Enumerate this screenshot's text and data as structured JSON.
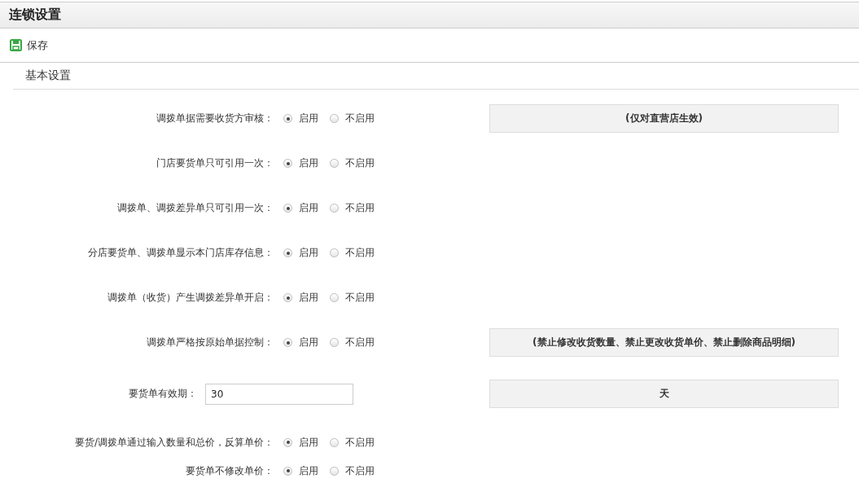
{
  "title": "连锁设置",
  "toolbar": [
    {
      "label": "保存",
      "kind": "save"
    }
  ],
  "section": {
    "title": "基本设置"
  },
  "settings": [
    {
      "kind": "radio",
      "label": "调拨单据需要收货方审核：",
      "options": [
        {
          "label": "启用",
          "selected": true
        },
        {
          "label": "不启用",
          "selected": false
        }
      ],
      "note": "(仅对直营店生效)"
    },
    {
      "kind": "radio",
      "label": "门店要货单只可引用一次：",
      "options": [
        {
          "label": "启用",
          "selected": true
        },
        {
          "label": "不启用",
          "selected": false
        }
      ]
    },
    {
      "kind": "radio",
      "label": "调拨单、调拨差异单只可引用一次：",
      "options": [
        {
          "label": "启用",
          "selected": true
        },
        {
          "label": "不启用",
          "selected": false
        }
      ]
    },
    {
      "kind": "radio",
      "label": "分店要货单、调拨单显示本门店库存信息：",
      "options": [
        {
          "label": "启用",
          "selected": true
        },
        {
          "label": "不启用",
          "selected": false
        }
      ]
    },
    {
      "kind": "radio",
      "label": "调拨单（收货）产生调拨差异单开启：",
      "options": [
        {
          "label": "启用",
          "selected": true
        },
        {
          "label": "不启用",
          "selected": false
        }
      ]
    },
    {
      "kind": "radio",
      "label": "调拨单严格按原始单据控制：",
      "options": [
        {
          "label": "启用",
          "selected": true
        },
        {
          "label": "不启用",
          "selected": false
        }
      ],
      "note": "(禁止修改收货数量、禁止更改收货单价、禁止删除商品明细)"
    },
    {
      "kind": "number",
      "label": "要货单有效期：",
      "value": "30",
      "note": "天"
    },
    {
      "kind": "radio",
      "label": "要货/调拨单通过输入数量和总价，反算单价：",
      "options": [
        {
          "label": "启用",
          "selected": true
        },
        {
          "label": "不启用",
          "selected": false
        }
      ]
    },
    {
      "kind": "radio",
      "label": "要货单不修改单价：",
      "options": [
        {
          "label": "启用",
          "selected": true
        },
        {
          "label": "不启用",
          "selected": false
        }
      ]
    }
  ]
}
